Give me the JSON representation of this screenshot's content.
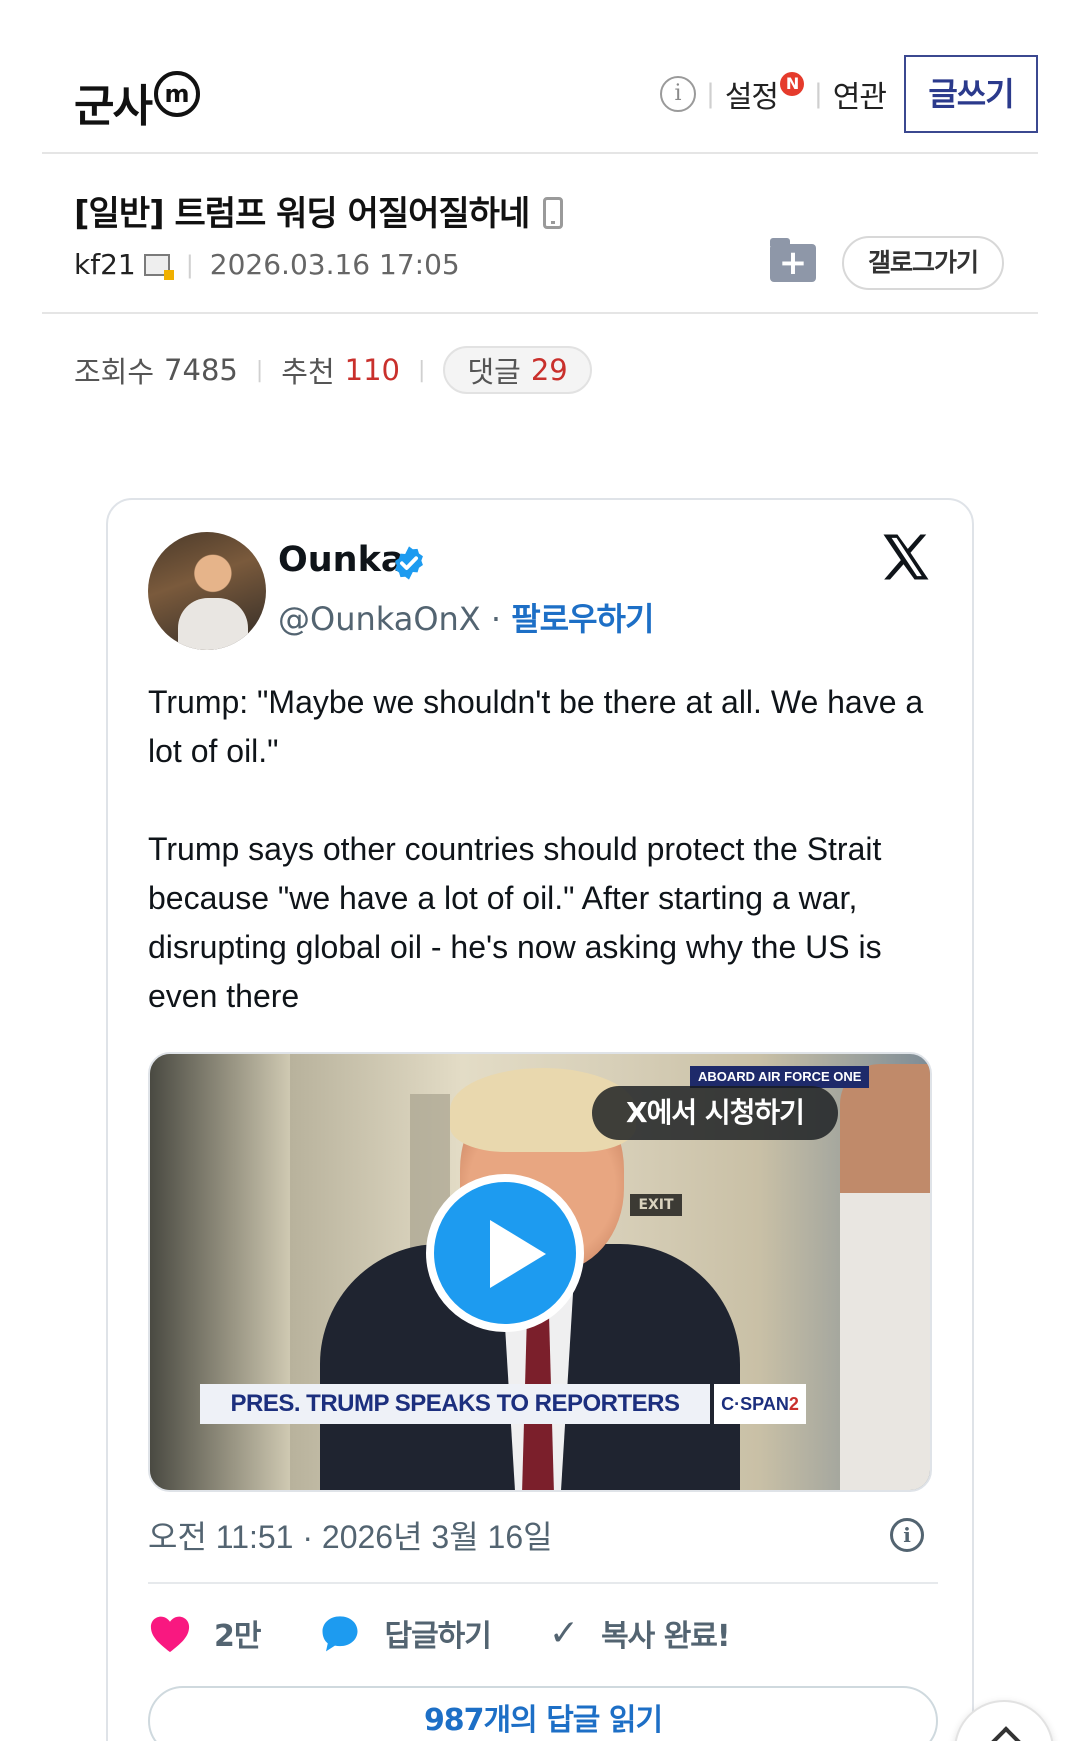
{
  "header": {
    "gallery_name": "군사",
    "badge": "m",
    "settings_label": "설정",
    "settings_badge": "N",
    "related_label": "연관",
    "write_label": "글쓰기"
  },
  "post": {
    "title": "[일반] 트럼프 워딩 어질어질하네",
    "writer": "kf21",
    "date": "2026.03.16 17:05",
    "gallery_button": "갤로그가기",
    "views_label": "조회수",
    "views": "7485",
    "recommend_label": "추천",
    "recommend": "110",
    "comments_label": "댓글",
    "comments": "29"
  },
  "tweet": {
    "author_name": "Ounka",
    "handle": "@OunkaOnX",
    "dot": "·",
    "follow_label": "팔로우하기",
    "paragraph1": "Trump: \"Maybe we shouldn't be there at all. We have a lot of oil.\"",
    "paragraph2": "Trump says other countries should protect the Strait because \"we have a lot of oil.\" After starting a war, disrupting global oil - he's now asking why the US is even there",
    "media": {
      "watch_label": "X에서 시청하기",
      "aboard_tag": "ABOARD AIR FORCE ONE",
      "exit_sign": "EXIT",
      "lower_third": "PRES. TRUMP SPEAKS TO REPORTERS",
      "network_a": "C·SPAN",
      "network_b": "2"
    },
    "timestamp": "오전 11:51 · 2026년 3월 16일",
    "likes": "2만",
    "reply_label": "답글하기",
    "copy_label": "복사 완료!",
    "read_replies": "987개의 답글 읽기"
  },
  "colors": {
    "accent_blue": "#1d9bf0",
    "link_blue": "#1d6fc6",
    "heart_pink": "#f91880",
    "count_red": "#c9302c",
    "write_border": "#3b4890"
  },
  "icons": [
    "info-icon",
    "mobile-icon",
    "folder-add-icon",
    "verified-icon",
    "x-logo-icon",
    "play-icon",
    "heart-icon",
    "reply-bubble-icon",
    "check-icon",
    "scroll-top-icon"
  ]
}
